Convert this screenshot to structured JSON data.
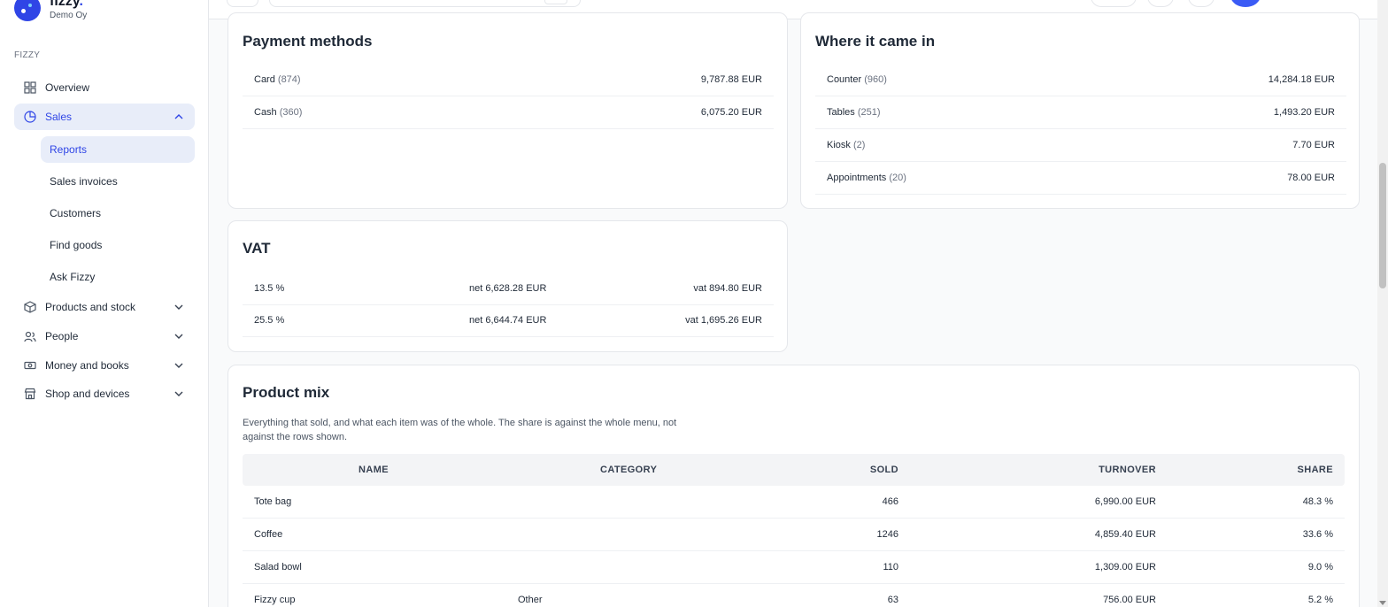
{
  "brand": {
    "name": "fizzy",
    "accent": ".",
    "company": "Demo Oy"
  },
  "sidebar": {
    "section": "FIZZY",
    "items": [
      {
        "label": "Overview",
        "icon": "grid-icon"
      },
      {
        "label": "Sales",
        "icon": "pie-chart-icon",
        "expanded": true
      },
      {
        "label": "Products and stock",
        "icon": "box-icon"
      },
      {
        "label": "People",
        "icon": "people-icon"
      },
      {
        "label": "Money and books",
        "icon": "banknote-icon"
      },
      {
        "label": "Shop and devices",
        "icon": "store-icon"
      }
    ],
    "sales_sub": [
      {
        "label": "Reports",
        "active": true
      },
      {
        "label": "Sales invoices"
      },
      {
        "label": "Customers"
      },
      {
        "label": "Find goods"
      },
      {
        "label": "Ask Fizzy"
      }
    ]
  },
  "payment_methods": {
    "title": "Payment methods",
    "rows": [
      {
        "name": "Card",
        "count": "(874)",
        "amount": "9,787.88 EUR"
      },
      {
        "name": "Cash",
        "count": "(360)",
        "amount": "6,075.20 EUR"
      }
    ]
  },
  "where_it_came_in": {
    "title": "Where it came in",
    "rows": [
      {
        "name": "Counter",
        "count": "(960)",
        "amount": "14,284.18 EUR"
      },
      {
        "name": "Tables",
        "count": "(251)",
        "amount": "1,493.20 EUR"
      },
      {
        "name": "Kiosk",
        "count": "(2)",
        "amount": "7.70 EUR"
      },
      {
        "name": "Appointments",
        "count": "(20)",
        "amount": "78.00 EUR"
      }
    ]
  },
  "vat": {
    "title": "VAT",
    "rows": [
      {
        "rate": "13.5 %",
        "net": "net 6,628.28 EUR",
        "vat": "vat 894.80 EUR"
      },
      {
        "rate": "25.5 %",
        "net": "net 6,644.74 EUR",
        "vat": "vat 1,695.26 EUR"
      }
    ]
  },
  "product_mix": {
    "title": "Product mix",
    "description": "Everything that sold, and what each item was of the whole. The share is against the whole menu, not against the rows shown.",
    "columns": {
      "name": "NAME",
      "category": "CATEGORY",
      "sold": "SOLD",
      "turnover": "TURNOVER",
      "share": "SHARE"
    },
    "rows": [
      {
        "name": "Tote bag",
        "category": "",
        "sold": "466",
        "turnover": "6,990.00 EUR",
        "share": "48.3 %"
      },
      {
        "name": "Coffee",
        "category": "",
        "sold": "1246",
        "turnover": "4,859.40 EUR",
        "share": "33.6 %"
      },
      {
        "name": "Salad bowl",
        "category": "",
        "sold": "110",
        "turnover": "1,309.00 EUR",
        "share": "9.0 %"
      },
      {
        "name": "Fizzy cup",
        "category": "Other",
        "sold": "63",
        "turnover": "756.00 EUR",
        "share": "5.2 %"
      }
    ]
  },
  "colors": {
    "accent": "#2f45e6",
    "active_bg": "#e8edf9"
  }
}
